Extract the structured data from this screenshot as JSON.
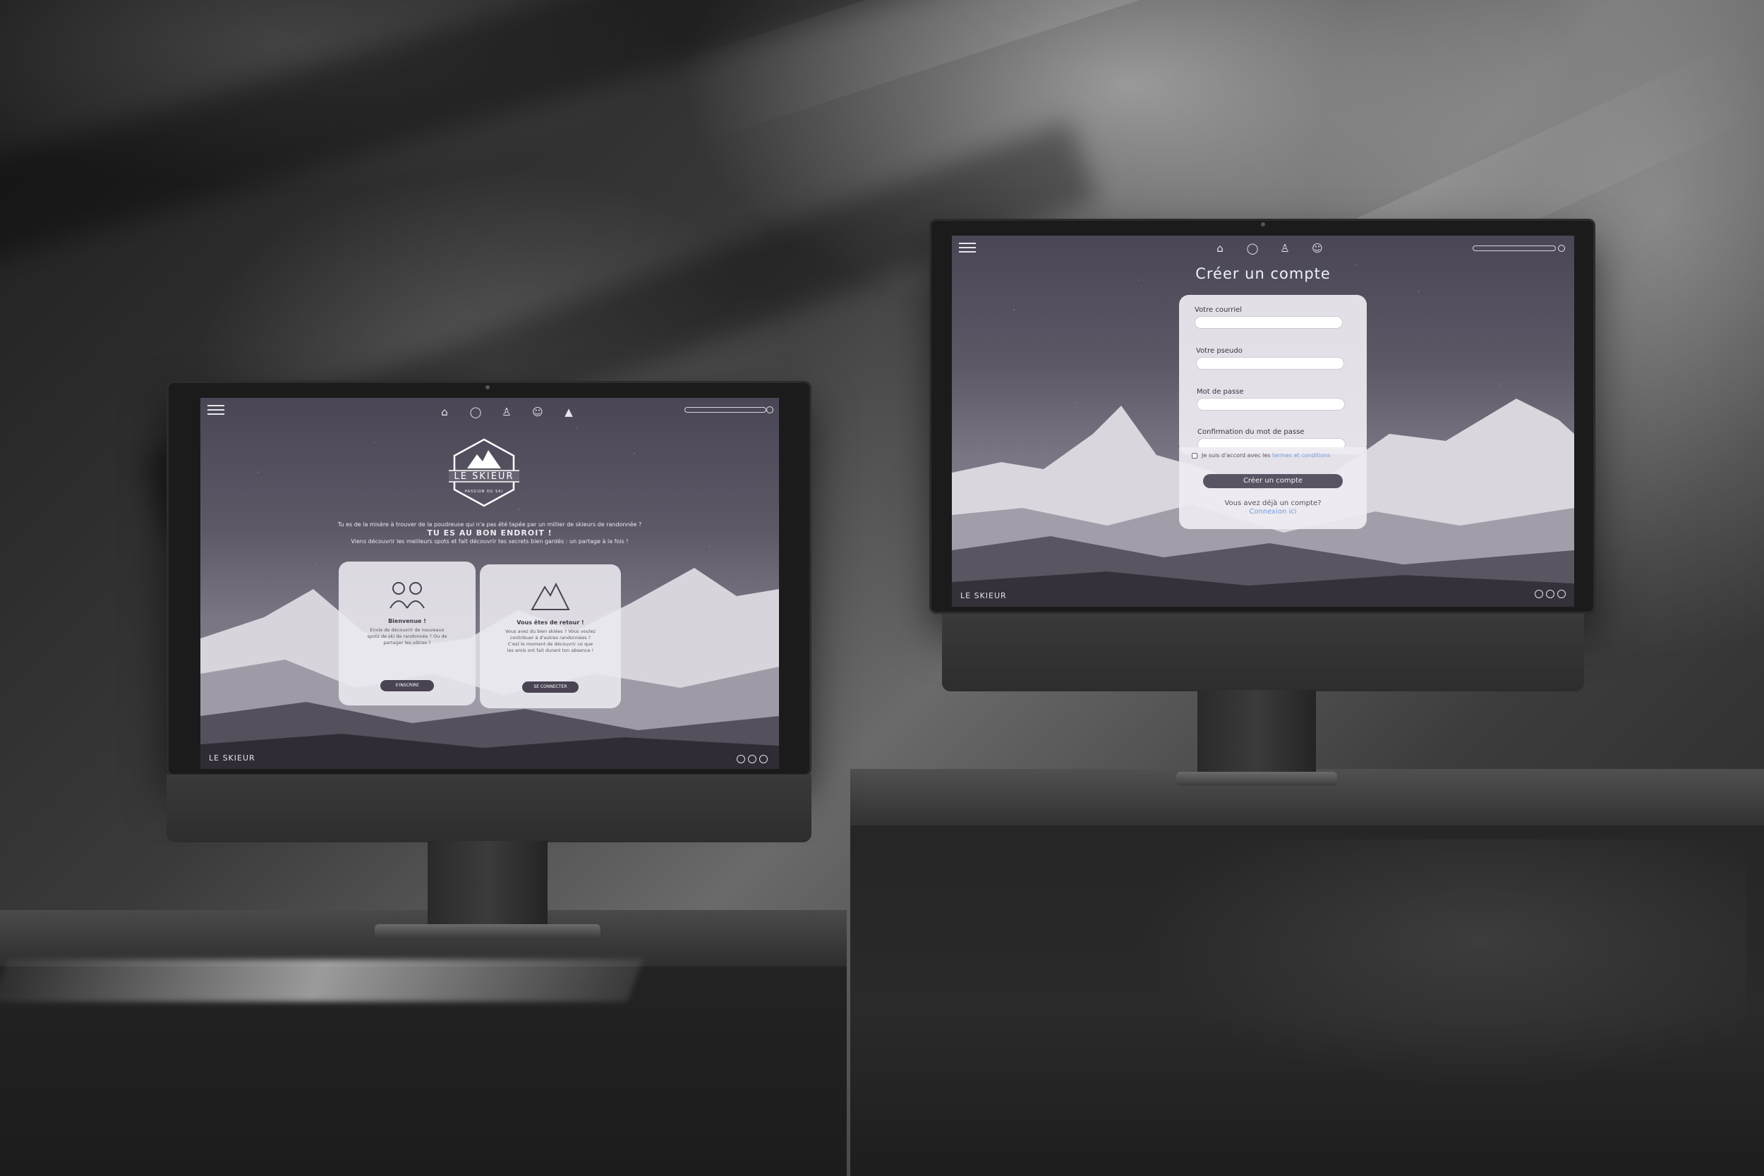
{
  "left_screen": {
    "logo": {
      "brand": "LE SKIEUR",
      "tagline": "PASSION DU SKI"
    },
    "hero": {
      "line1": "Tu es de la misère à trouver de la poudreuse qui n'a pas été tapée par un millier de skieurs de randonnée ?",
      "headline": "TU ES AU BON ENDROIT !",
      "line2": "Viens découvrir les meilleurs spots et fait découvrir tes secrets bien gardés : un partage à la fois !"
    },
    "cards": [
      {
        "title": "Bienvenue !",
        "text": "Envie de découvrir de nouveaux spots de ski de randonnée ? Ou de partager les vôtres ?",
        "button": "S'INSCRIRE"
      },
      {
        "title": "Vous êtes de retour !",
        "text": "Vous avez du bien skiées ? Vous voulez contribuer à d'autres randonnées ? C'est le moment de découvrir ce que les amis ont fait durant ton absence !",
        "button": "SE CONNECTER"
      }
    ]
  },
  "right_screen": {
    "title": "Créer un compte",
    "fields": [
      {
        "label": "Votre courriel",
        "value": ""
      },
      {
        "label": "Votre pseudo",
        "value": ""
      },
      {
        "label": "Mot de passe",
        "value": ""
      },
      {
        "label": "Confirmation du mot de passe",
        "value": ""
      }
    ],
    "terms_prefix": "Je suis d'accord avec les",
    "terms_link": "termes et conditions",
    "submit": "Créer un compte",
    "footer_question": "Vous avez déjà un compte?",
    "footer_link": "Connexion ici",
    "footer_logo": "LE SKIEUR"
  },
  "nav": {
    "icons": [
      "home-icon",
      "chat-icon",
      "backpack-icon",
      "user-icon",
      "mountain-icon"
    ]
  },
  "colors": {
    "accent_link": "#6f9fd8",
    "button": "#5a5362",
    "sky": "#5d5866"
  }
}
